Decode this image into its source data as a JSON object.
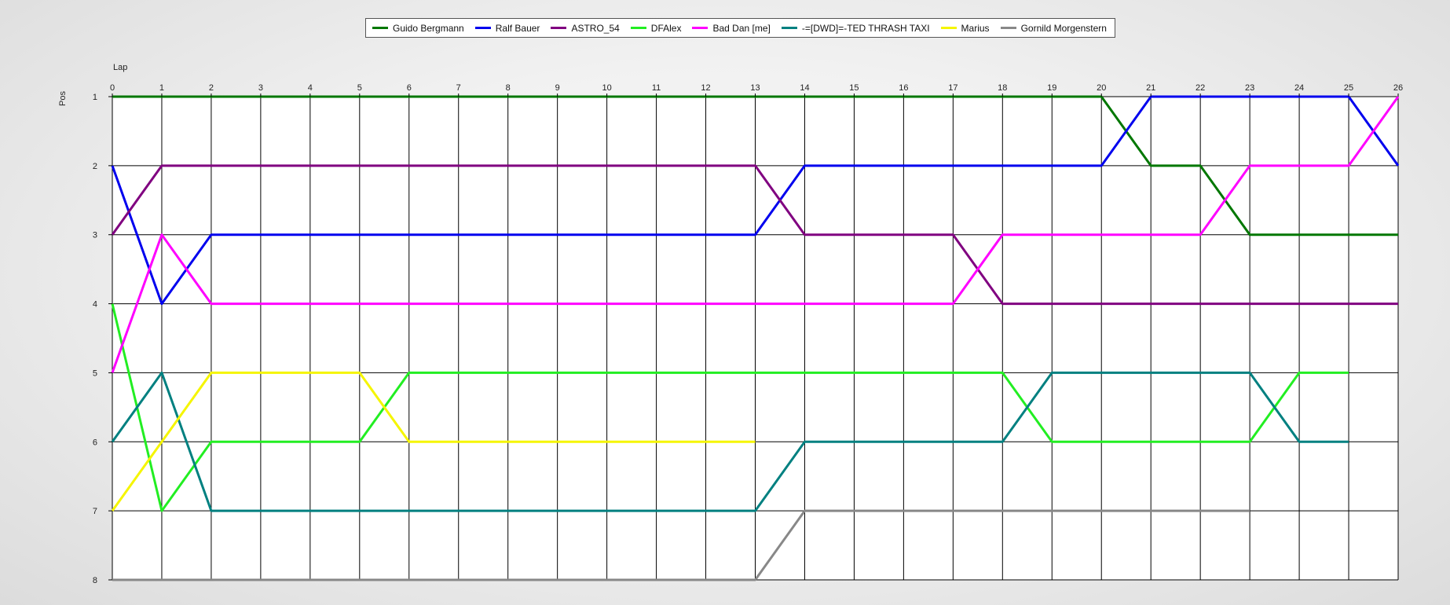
{
  "chart_data": {
    "type": "line",
    "xlabel": "Lap",
    "ylabel": "Pos",
    "x": [
      0,
      1,
      2,
      3,
      4,
      5,
      6,
      7,
      8,
      9,
      10,
      11,
      12,
      13,
      14,
      15,
      16,
      17,
      18,
      19,
      20,
      21,
      22,
      23,
      24,
      25,
      26
    ],
    "y_ticks": [
      1,
      2,
      3,
      4,
      5,
      6,
      7,
      8
    ],
    "xlim": [
      0,
      26
    ],
    "ylim": [
      1,
      8
    ],
    "y_inverted": true,
    "grid": true,
    "legend_position": "top-center",
    "series": [
      {
        "name": "Guido Bergmann",
        "color": "#007700",
        "values": [
          1,
          1,
          1,
          1,
          1,
          1,
          1,
          1,
          1,
          1,
          1,
          1,
          1,
          1,
          1,
          1,
          1,
          1,
          1,
          1,
          1,
          2,
          2,
          3,
          3,
          3,
          3
        ]
      },
      {
        "name": "Ralf Bauer",
        "color": "#0000ee",
        "values": [
          2,
          4,
          3,
          3,
          3,
          3,
          3,
          3,
          3,
          3,
          3,
          3,
          3,
          3,
          2,
          2,
          2,
          2,
          2,
          2,
          2,
          1,
          1,
          1,
          1,
          1,
          2
        ]
      },
      {
        "name": "ASTRO_54",
        "color": "#800080",
        "values": [
          3,
          2,
          2,
          2,
          2,
          2,
          2,
          2,
          2,
          2,
          2,
          2,
          2,
          2,
          3,
          3,
          3,
          3,
          4,
          4,
          4,
          4,
          4,
          4,
          4,
          4,
          4
        ]
      },
      {
        "name": "DFAlex",
        "color": "#22ee22",
        "values": [
          4,
          7,
          6,
          6,
          6,
          6,
          5,
          5,
          5,
          5,
          5,
          5,
          5,
          5,
          5,
          5,
          5,
          5,
          5,
          6,
          6,
          6,
          6,
          6,
          5,
          5
        ]
      },
      {
        "name": "Bad Dan [me]",
        "color": "#ff00ff",
        "values": [
          5,
          3,
          4,
          4,
          4,
          4,
          4,
          4,
          4,
          4,
          4,
          4,
          4,
          4,
          4,
          4,
          4,
          4,
          3,
          3,
          3,
          3,
          3,
          2,
          2,
          2,
          1
        ]
      },
      {
        "name": "-=[DWD]=-TED THRASH TAXI",
        "color": "#008080",
        "values": [
          6,
          5,
          7,
          7,
          7,
          7,
          7,
          7,
          7,
          7,
          7,
          7,
          7,
          7,
          6,
          6,
          6,
          6,
          6,
          5,
          5,
          5,
          5,
          5,
          6,
          6
        ]
      },
      {
        "name": "Marius",
        "color": "#f5f500",
        "values": [
          7,
          6,
          5,
          5,
          5,
          5,
          6,
          6,
          6,
          6,
          6,
          6,
          6,
          6
        ]
      },
      {
        "name": "Gornild Morgenstern",
        "color": "#888888",
        "values": [
          8,
          8,
          8,
          8,
          8,
          8,
          8,
          8,
          8,
          8,
          8,
          8,
          8,
          8,
          7,
          7,
          7,
          7,
          7,
          7,
          7,
          7,
          7,
          7
        ]
      }
    ]
  }
}
